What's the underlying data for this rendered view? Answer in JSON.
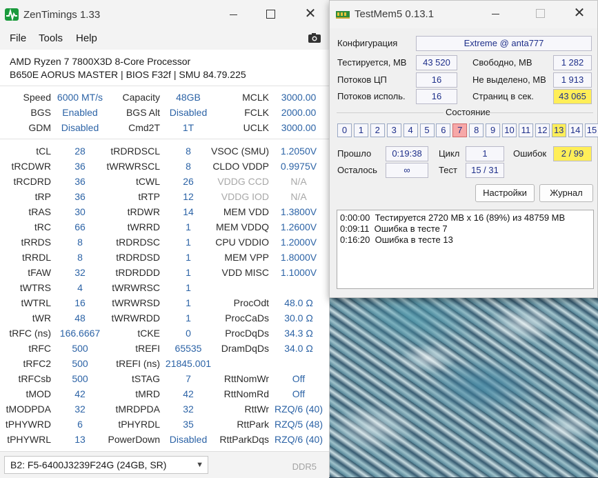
{
  "zentimings": {
    "title": "ZenTimings 1.33",
    "menu": [
      "File",
      "Tools",
      "Help"
    ],
    "cpu": "AMD Ryzen 7 7800X3D 8-Core Processor",
    "board": "B650E AORUS MASTER | BIOS F32f | SMU 84.79.225",
    "summary": [
      {
        "l1": "Speed",
        "v1": "6000 MT/s",
        "l2": "Capacity",
        "v2": "48GB",
        "l3": "MCLK",
        "v3": "3000.00"
      },
      {
        "l1": "BGS",
        "v1": "Enabled",
        "l2": "BGS Alt",
        "v2": "Disabled",
        "l3": "FCLK",
        "v3": "2000.00"
      },
      {
        "l1": "GDM",
        "v1": "Disabled",
        "l2": "Cmd2T",
        "v2": "1T",
        "l3": "UCLK",
        "v3": "3000.00"
      }
    ],
    "timings": [
      {
        "l1": "tCL",
        "v1": "28",
        "l2": "tRDRDSCL",
        "v2": "8",
        "l3": "VSOC (SMU)",
        "v3": "1.2050V"
      },
      {
        "l1": "tRCDWR",
        "v1": "36",
        "l2": "tWRWRSCL",
        "v2": "8",
        "l3": "CLDO VDDP",
        "v3": "0.9975V"
      },
      {
        "l1": "tRCDRD",
        "v1": "36",
        "l2": "tCWL",
        "v2": "26",
        "l3": "VDDG CCD",
        "v3": "N/A"
      },
      {
        "l1": "tRP",
        "v1": "36",
        "l2": "tRTP",
        "v2": "12",
        "l3": "VDDG IOD",
        "v3": "N/A"
      },
      {
        "l1": "tRAS",
        "v1": "30",
        "l2": "tRDWR",
        "v2": "14",
        "l3": "MEM VDD",
        "v3": "1.3800V"
      },
      {
        "l1": "tRC",
        "v1": "66",
        "l2": "tWRRD",
        "v2": "1",
        "l3": "MEM VDDQ",
        "v3": "1.2600V"
      },
      {
        "l1": "tRRDS",
        "v1": "8",
        "l2": "tRDRDSC",
        "v2": "1",
        "l3": "CPU VDDIO",
        "v3": "1.2000V"
      },
      {
        "l1": "tRRDL",
        "v1": "8",
        "l2": "tRDRDSD",
        "v2": "1",
        "l3": "MEM VPP",
        "v3": "1.8000V"
      },
      {
        "l1": "tFAW",
        "v1": "32",
        "l2": "tRDRDDD",
        "v2": "1",
        "l3": "VDD MISC",
        "v3": "1.1000V"
      },
      {
        "l1": "tWTRS",
        "v1": "4",
        "l2": "tWRWRSC",
        "v2": "1",
        "l3": "",
        "v3": ""
      },
      {
        "l1": "tWTRL",
        "v1": "16",
        "l2": "tWRWRSD",
        "v2": "1",
        "l3": "ProcOdt",
        "v3": "48.0 Ω"
      },
      {
        "l1": "tWR",
        "v1": "48",
        "l2": "tWRWRDD",
        "v2": "1",
        "l3": "ProcCaDs",
        "v3": "30.0 Ω"
      },
      {
        "l1": "tRFC (ns)",
        "v1": "166.6667",
        "l2": "tCKE",
        "v2": "0",
        "l3": "ProcDqDs",
        "v3": "34.3 Ω"
      },
      {
        "l1": "tRFC",
        "v1": "500",
        "l2": "tREFI",
        "v2": "65535",
        "l3": "DramDqDs",
        "v3": "34.0 Ω"
      },
      {
        "l1": "tRFC2",
        "v1": "500",
        "l2": "tREFI (ns)",
        "v2": "21845.001",
        "l3": "",
        "v3": ""
      },
      {
        "l1": "tRFCsb",
        "v1": "500",
        "l2": "tSTAG",
        "v2": "7",
        "l3": "RttNomWr",
        "v3": "Off"
      },
      {
        "l1": "tMOD",
        "v1": "42",
        "l2": "tMRD",
        "v2": "42",
        "l3": "RttNomRd",
        "v3": "Off"
      },
      {
        "l1": "tMODPDA",
        "v1": "32",
        "l2": "tMRDPDA",
        "v2": "32",
        "l3": "RttWr",
        "v3": "RZQ/6 (40)"
      },
      {
        "l1": "tPHYWRD",
        "v1": "6",
        "l2": "tPHYRDL",
        "v2": "35",
        "l3": "RttPark",
        "v3": "RZQ/5 (48)"
      },
      {
        "l1": "tPHYWRL",
        "v1": "13",
        "l2": "PowerDown",
        "v2": "Disabled",
        "l3": "RttParkDqs",
        "v3": "RZQ/6 (40)"
      }
    ],
    "dimm_selected": "B2: F5-6400J3239F24G (24GB, SR)",
    "memory_type": "DDR5"
  },
  "testmem": {
    "title": "TestMem5  0.13.1",
    "config_label": "Конфигурация",
    "config_value": "Extreme @ anta777",
    "tested_label": "Тестируется, MB",
    "tested_value": "43 520",
    "free_label": "Свободно, MB",
    "free_value": "1 282",
    "threads_cpu_label": "Потоков ЦП",
    "threads_cpu_value": "16",
    "unallocated_label": "Не выделено, MB",
    "unallocated_value": "1 913",
    "threads_used_label": "Потоков исполь.",
    "threads_used_value": "16",
    "pages_label": "Страниц в сек.",
    "pages_value": "43 065",
    "status_label": "Состояние",
    "status_cells": [
      "0",
      "1",
      "2",
      "3",
      "4",
      "5",
      "6",
      "7",
      "8",
      "9",
      "10",
      "11",
      "12",
      "13",
      "14",
      "15"
    ],
    "error_cells": [
      "7"
    ],
    "highlight_cells": [
      "13"
    ],
    "elapsed_label": "Прошло",
    "elapsed_value": "0:19:38",
    "cycle_label": "Цикл",
    "cycle_value": "1",
    "errors_label": "Ошибок",
    "errors_value": "2 / 99",
    "remaining_label": "Осталось",
    "remaining_value": "∞",
    "test_label": "Тест",
    "test_value": "15 / 31",
    "settings_button": "Настройки",
    "log_button": "Журнал",
    "log": [
      {
        "time": "0:00:00",
        "text": "Тестируется 2720 MB x 16 (89%) из 48759 MB"
      },
      {
        "time": "0:09:11",
        "text": "Ошибка в тесте 7"
      },
      {
        "time": "0:16:20",
        "text": "Ошибка в тесте 13"
      }
    ]
  }
}
